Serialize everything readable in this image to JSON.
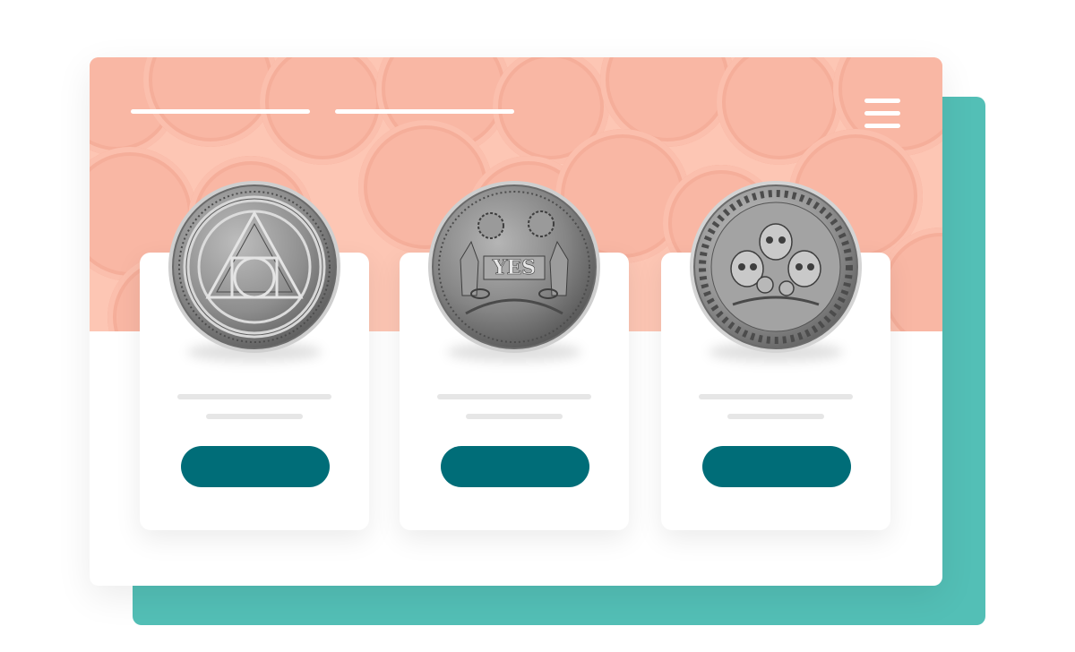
{
  "colors": {
    "accent_back_panel": "#53bfb6",
    "hero_background": "#fdc6b4",
    "button": "#006d78",
    "placeholder_line": "#e6e6e6"
  },
  "header": {
    "nav_placeholders": [
      "nav-placeholder-1",
      "nav-placeholder-2"
    ],
    "menu_icon": "hamburger-menu-icon"
  },
  "products": [
    {
      "image": "ouroboros-alchemy-coin",
      "button_label": ""
    },
    {
      "image": "yes-oracle-coin",
      "button_label": ""
    },
    {
      "image": "skulls-roses-coin",
      "button_label": ""
    }
  ]
}
